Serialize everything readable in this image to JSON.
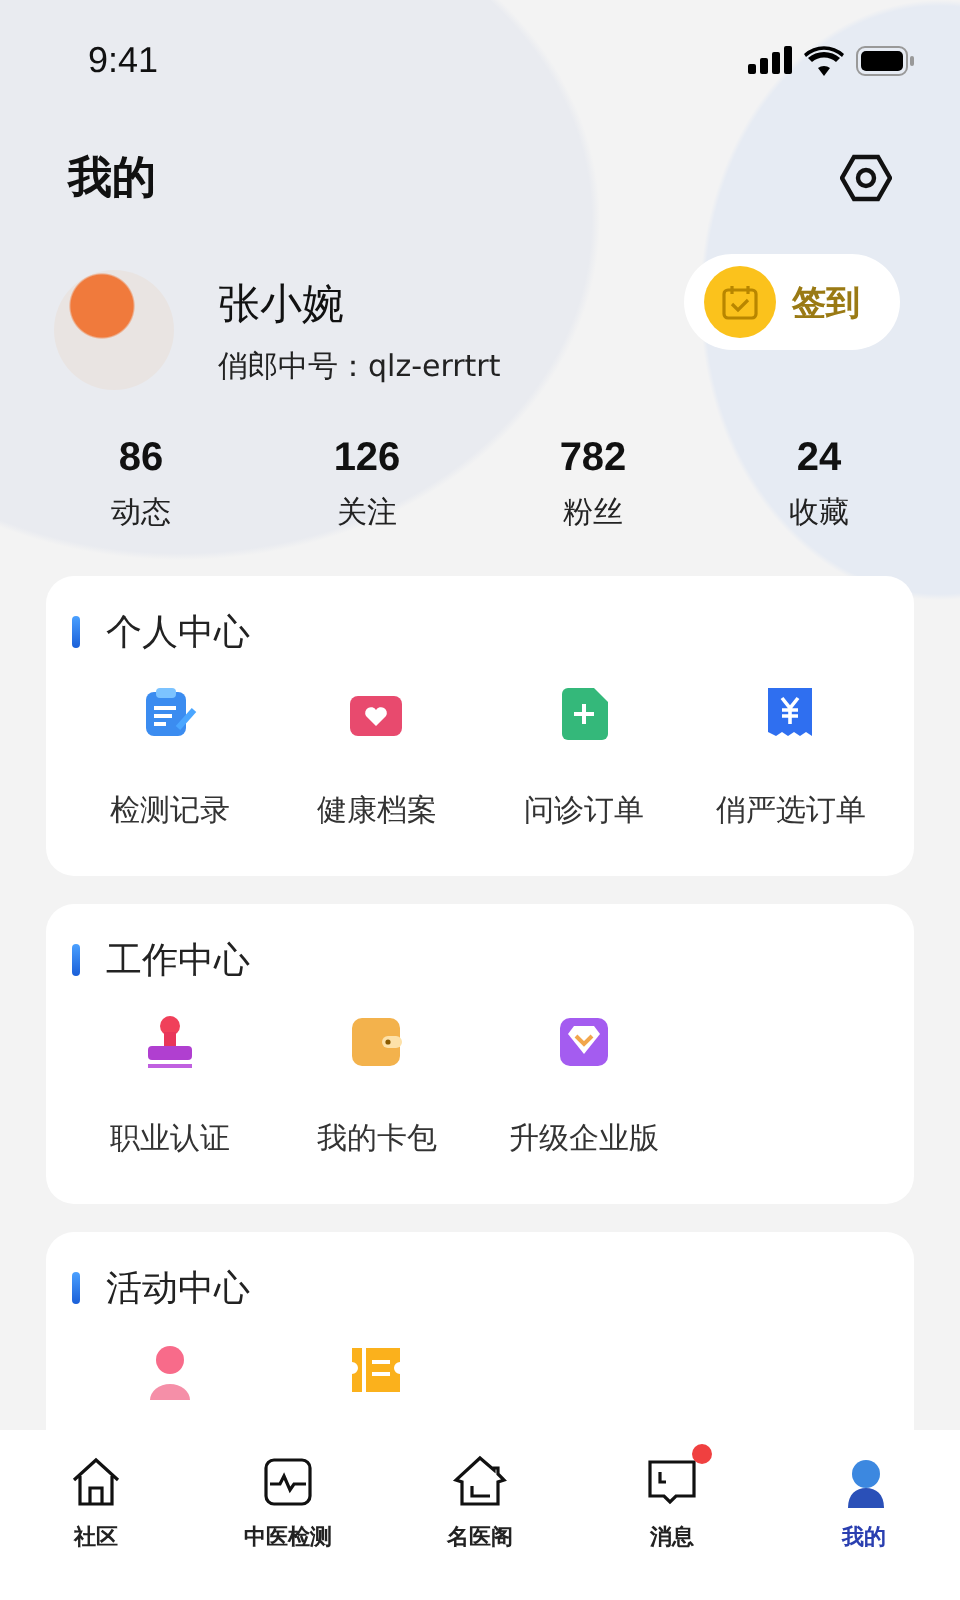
{
  "status_bar": {
    "time": "9:41"
  },
  "header": {
    "title": "我的"
  },
  "profile": {
    "name": "张小婉",
    "account": "俏郎中号：qlz-errtrt",
    "checkin": "签到"
  },
  "stats": [
    {
      "value": "86",
      "label": "动态"
    },
    {
      "value": "126",
      "label": "关注"
    },
    {
      "value": "782",
      "label": "粉丝"
    },
    {
      "value": "24",
      "label": "收藏"
    }
  ],
  "sections": [
    {
      "title": "个人中心",
      "items": [
        {
          "kind": "notepad",
          "label": "检测记录"
        },
        {
          "kind": "folder",
          "label": "健康档案"
        },
        {
          "kind": "document",
          "label": "问诊订单"
        },
        {
          "kind": "receipt",
          "label": "俏严选订单"
        }
      ]
    },
    {
      "title": "工作中心",
      "items": [
        {
          "kind": "stamp",
          "label": "职业认证"
        },
        {
          "kind": "wallet",
          "label": "我的卡包"
        },
        {
          "kind": "diamond",
          "label": "升级企业版"
        }
      ]
    },
    {
      "title": "活动中心",
      "items": [
        {
          "kind": "person"
        },
        {
          "kind": "ticket"
        }
      ]
    }
  ],
  "tab_bar": [
    {
      "kind": "house",
      "label": "社区",
      "selected": false,
      "unread": false
    },
    {
      "kind": "monitor",
      "label": "中医检测",
      "selected": false,
      "unread": false
    },
    {
      "kind": "hall",
      "label": "名医阁",
      "selected": false,
      "unread": false
    },
    {
      "kind": "chat",
      "label": "消息",
      "selected": false,
      "unread": true
    },
    {
      "kind": "user",
      "label": "我的",
      "selected": true,
      "unread": false
    }
  ]
}
